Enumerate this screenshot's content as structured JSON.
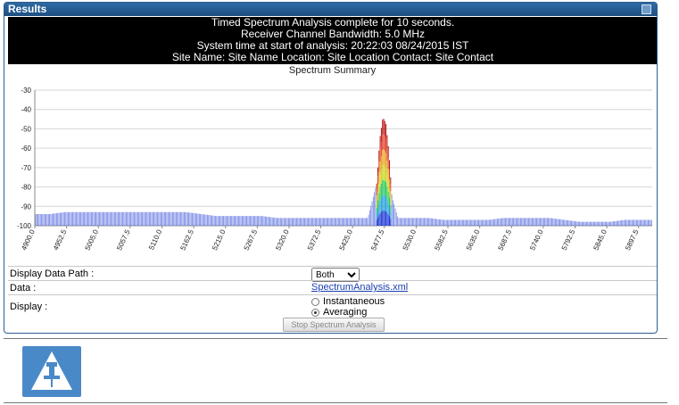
{
  "panel": {
    "title": "Results"
  },
  "summary_lines": [
    "Timed Spectrum Analysis complete for 10 seconds.",
    "Receiver Channel Bandwidth: 5.0 MHz",
    "System time at start of analysis: 20:22:03 08/24/2015 IST",
    "Site Name: Site Name  Location: Site Location  Contact: Site Contact"
  ],
  "chart_data": {
    "type": "bar",
    "title": "Spectrum Summary",
    "xlabel": "",
    "ylabel": "",
    "ylim": [
      -100,
      -30
    ],
    "yticks": [
      "-30",
      "-40",
      "-50",
      "-60",
      "-70",
      "-80",
      "-90",
      "-100"
    ],
    "xticks": [
      "4900.0",
      "4952.5",
      "5005.0",
      "5057.5",
      "5110.0",
      "5162.5",
      "5215.0",
      "5267.5",
      "5320.0",
      "5372.5",
      "5425.0",
      "5477.5",
      "5530.0",
      "5582.5",
      "5635.0",
      "5687.5",
      "5740.0",
      "5792.5",
      "5845.0",
      "5897.5"
    ],
    "grid": true,
    "series": [
      {
        "x": [
          4900,
          4925,
          4950,
          4975,
          5000,
          5025,
          5050,
          5075,
          5100,
          5125,
          5150,
          5175,
          5200,
          5225,
          5250,
          5275,
          5300,
          5325,
          5350,
          5375,
          5400,
          5425,
          5450,
          5465,
          5470,
          5475,
          5480,
          5485,
          5490,
          5500,
          5525,
          5550,
          5575,
          5600,
          5625,
          5650,
          5675,
          5700,
          5725,
          5750,
          5775,
          5800,
          5825,
          5850,
          5875,
          5900,
          5920
        ],
        "values": [
          -94,
          -94,
          -93,
          -93,
          -93,
          -93,
          -93,
          -93,
          -93,
          -93,
          -93,
          -94,
          -95,
          -95,
          -95,
          -95,
          -96,
          -96,
          -96,
          -96,
          -96,
          -96,
          -96,
          -78,
          -55,
          -44,
          -47,
          -62,
          -85,
          -96,
          -96,
          -96,
          -97,
          -97,
          -97,
          -97,
          -96,
          -96,
          -96,
          -96,
          -97,
          -98,
          -98,
          -98,
          -97,
          -97,
          -97
        ]
      }
    ],
    "peak_colors": [
      "#1a35d6",
      "#1ea0d8",
      "#23c75a",
      "#c8d41c",
      "#e8a21e",
      "#e23a1e",
      "#b51418"
    ]
  },
  "rows": {
    "data_path": {
      "label": "Display Data Path :",
      "value": "Both"
    },
    "data": {
      "label": "Data :",
      "link": "SpectrumAnalysis.xml"
    },
    "display": {
      "label": "Display :",
      "option1": "Instantaneous",
      "option2": "Averaging"
    }
  },
  "stop_button": "Stop Spectrum Analysis",
  "note_icon": "pushpin-icon"
}
